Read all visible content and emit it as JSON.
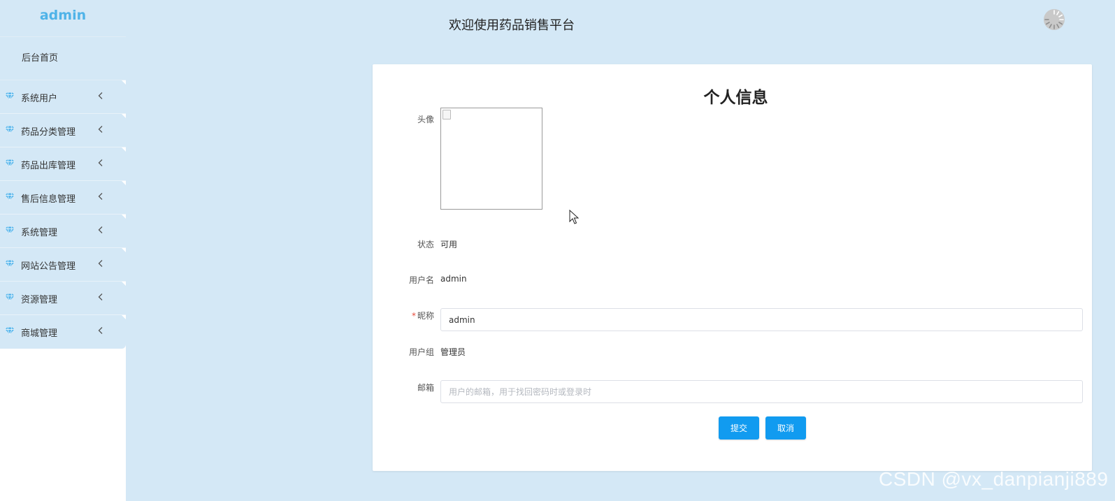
{
  "sidebar": {
    "brand": "admin",
    "home": "后台首页",
    "items": [
      {
        "label": "系统用户",
        "icon": "diamond-icon"
      },
      {
        "label": "药品分类管理",
        "icon": "diamond-icon"
      },
      {
        "label": "药品出库管理",
        "icon": "diamond-icon"
      },
      {
        "label": "售后信息管理",
        "icon": "diamond-icon"
      },
      {
        "label": "系统管理",
        "icon": "diamond-icon"
      },
      {
        "label": "网站公告管理",
        "icon": "diamond-icon"
      },
      {
        "label": "资源管理",
        "icon": "diamond-icon"
      },
      {
        "label": "商城管理",
        "icon": "diamond-icon"
      }
    ]
  },
  "header": {
    "title": "欢迎使用药品销售平台",
    "loader_icon": "loading-spinner-icon"
  },
  "profile": {
    "title": "个人信息",
    "avatar_label": "头像",
    "status_label": "状态",
    "status_value": "可用",
    "username_label": "用户名",
    "username_value": "admin",
    "nickname_required_mark": "*",
    "nickname_label": "昵称",
    "nickname_value": "admin",
    "group_label": "用户组",
    "group_value": "管理员",
    "email_label": "邮箱",
    "email_value": "",
    "email_placeholder": "用户的邮箱，用于找回密码时或登录时",
    "submit_label": "提交",
    "cancel_label": "取消"
  },
  "colors": {
    "background": "#d4e8f6",
    "accent": "#119bf0",
    "brand": "#4fb3e8"
  },
  "watermark": "CSDN @vx_danpianji889"
}
